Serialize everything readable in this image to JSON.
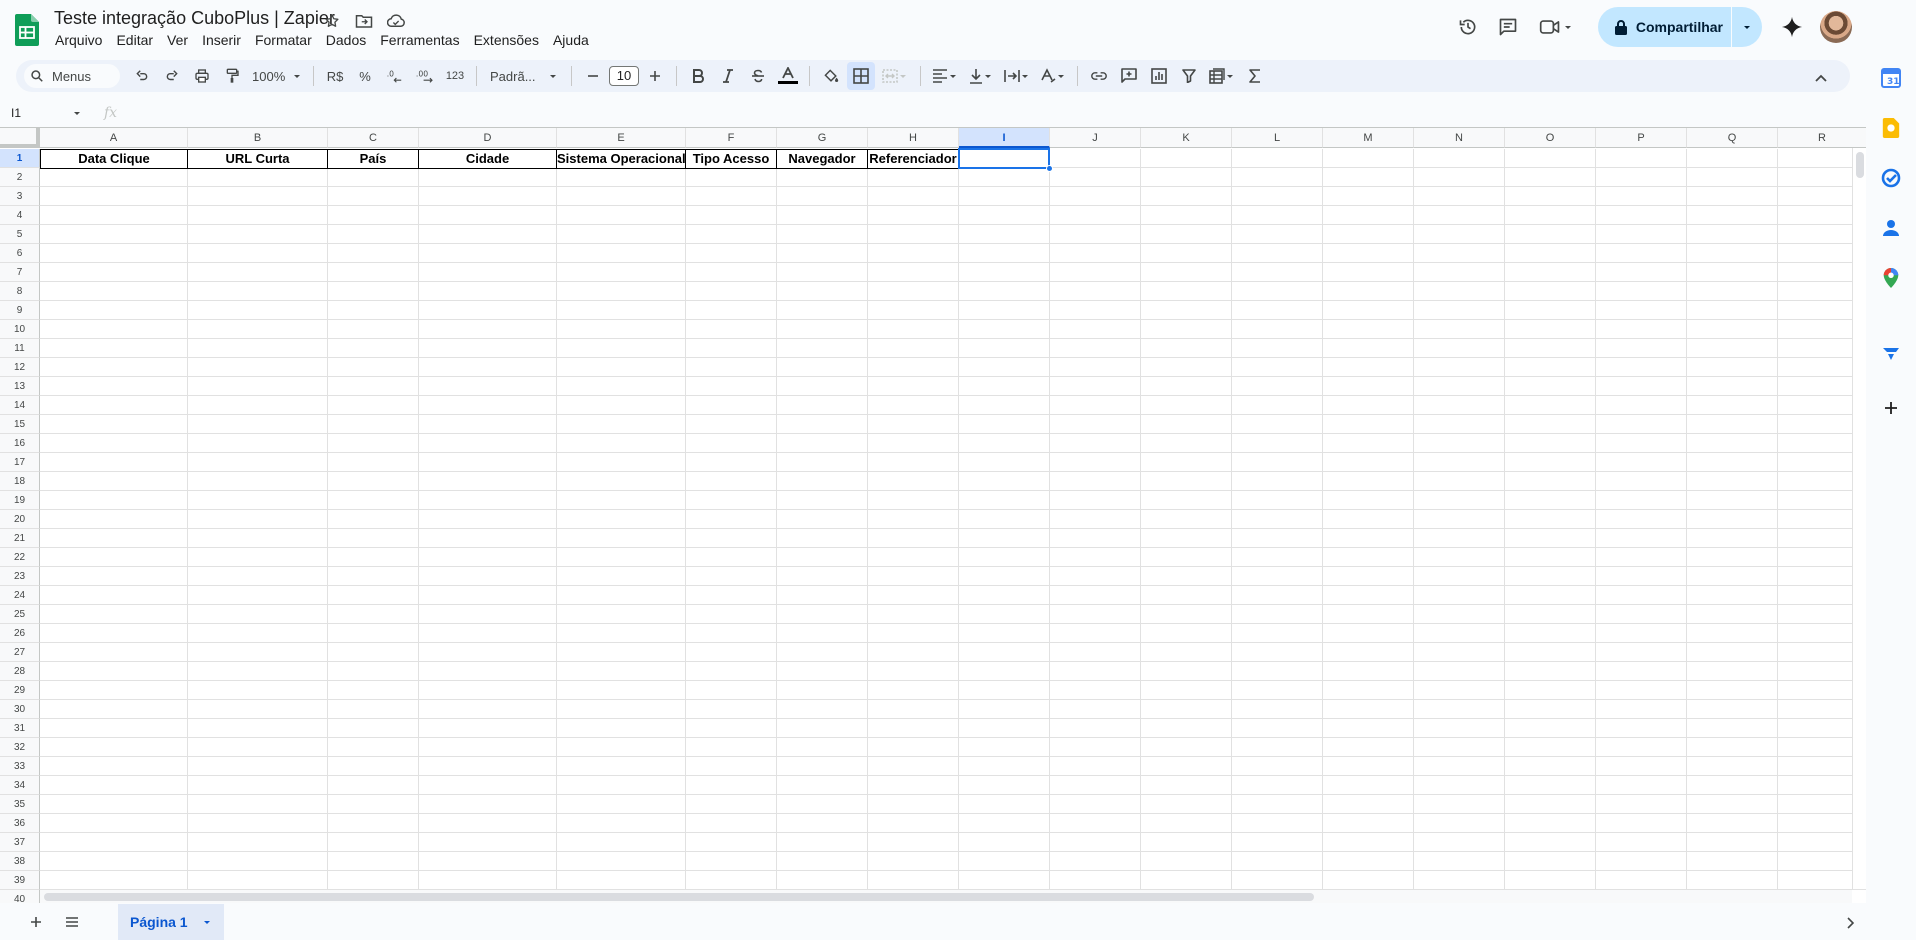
{
  "document": {
    "title": "Teste integração CuboPlus | Zapier"
  },
  "menu": [
    "Arquivo",
    "Editar",
    "Ver",
    "Inserir",
    "Formatar",
    "Dados",
    "Ferramentas",
    "Extensões",
    "Ajuda"
  ],
  "header_actions": {
    "share_label": "Compartilhar"
  },
  "toolbar": {
    "search_label": "Menus",
    "zoom": "100%",
    "currency": "R$",
    "percent": "%",
    "number_format": "123",
    "font_family": "Padrã...",
    "font_size": "10"
  },
  "formula_bar": {
    "name_box": "I1",
    "fx": "fx",
    "value": ""
  },
  "grid": {
    "columns": [
      "A",
      "B",
      "C",
      "D",
      "E",
      "F",
      "G",
      "H",
      "I",
      "J",
      "K",
      "L",
      "M",
      "N",
      "O",
      "P",
      "Q",
      "R"
    ],
    "selected_column": "I",
    "selected_row": 1,
    "rows": [
      "1",
      "2",
      "3",
      "4",
      "5",
      "6",
      "7",
      "8",
      "9",
      "10",
      "11",
      "12",
      "13",
      "14",
      "15",
      "16",
      "17",
      "18",
      "19",
      "20",
      "21",
      "22",
      "23",
      "24",
      "25",
      "26",
      "27",
      "28",
      "29",
      "30",
      "31",
      "32",
      "33",
      "34",
      "35",
      "36",
      "37",
      "38",
      "39",
      "40"
    ],
    "header_row": [
      "Data Clique",
      "URL Curta",
      "País",
      "Cidade",
      "Sistema Operacional",
      "Tipo Acesso",
      "Navegador",
      "Referenciador"
    ]
  },
  "sheets": {
    "active": "Página 1"
  },
  "colors": {
    "accent": "#0b57d0",
    "selection": "#1a73e8",
    "share_bg": "#c2e7ff",
    "toolbar_bg": "#edf2fa",
    "sheets_green": "#0f9d58"
  }
}
